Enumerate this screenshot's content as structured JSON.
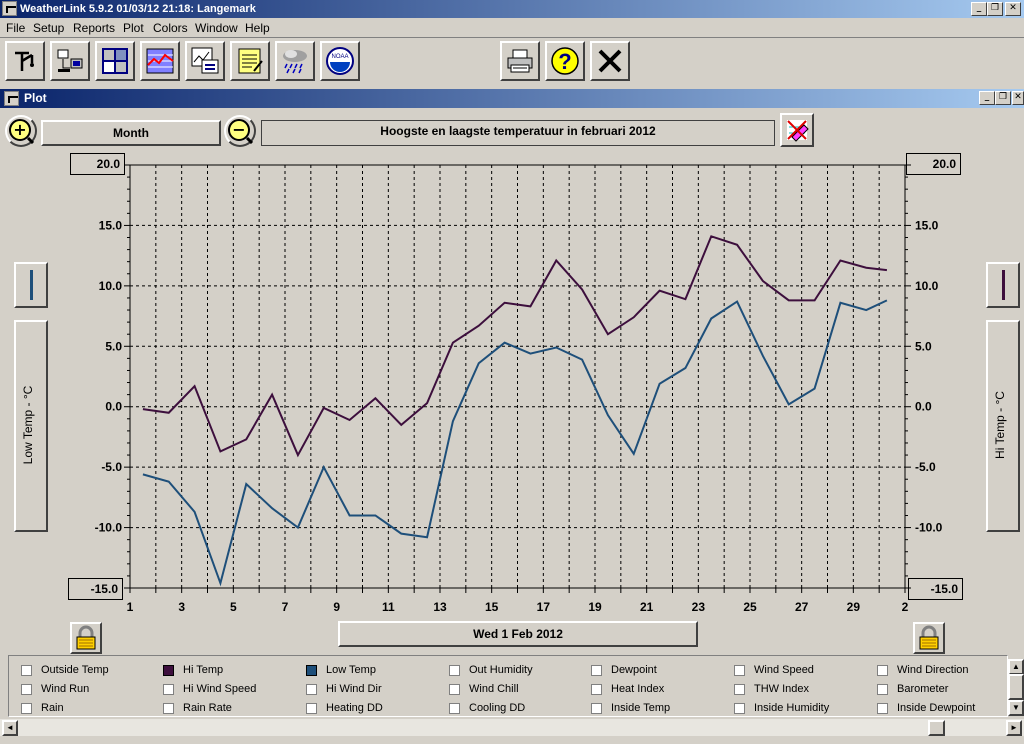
{
  "app": {
    "title": "WeatherLink 5.9.2  01/03/12  21:18: Langemark",
    "buttons": {
      "minimize": "_",
      "restore": "❐",
      "close": "✕"
    }
  },
  "menu": [
    "File",
    "Setup",
    "Reports",
    "Plot",
    "Colors",
    "Window",
    "Help"
  ],
  "toolbar": {
    "icons": [
      "weather-station-icon",
      "download-icon",
      "bulletin-icon",
      "strip-chart-icon",
      "plot-icon",
      "notepad-icon",
      "rain-icon",
      "noaa-icon"
    ],
    "right_icons": [
      "print-icon",
      "help-icon",
      "close-icon"
    ],
    "help_glyph": "?",
    "close_glyph": "✕",
    "noaa_text": "NOAA"
  },
  "plot_window": {
    "title": "Plot",
    "zoom_in": "+",
    "zoom_out": "−",
    "span": "Month",
    "chart_title": "Hoogste en laagste temperatuur in februari 2012",
    "date_button": "Wed 1 Feb 2012",
    "left_axis_label": "Low Temp - °C",
    "right_axis_label": "Hi Temp - °C"
  },
  "chart_data": {
    "type": "line",
    "title": "Hoogste en laagste temperatuur in februari 2012",
    "xlabel": "Wed 1 Feb 2012",
    "ylabel": "Low Temp - °C",
    "y2label": "Hi Temp - °C",
    "ylim": [
      -15,
      20
    ],
    "y_ticks": [
      "20.0",
      "15.0",
      "10.0",
      "5.0",
      "0.0",
      "-5.0",
      "-10.0",
      "-15.0"
    ],
    "x_ticks": [
      "1",
      "3",
      "5",
      "7",
      "9",
      "11",
      "13",
      "15",
      "17",
      "19",
      "21",
      "23",
      "25",
      "27",
      "29",
      "2"
    ],
    "grid": true,
    "series": [
      {
        "name": "Hi Temp",
        "color": "#3d0f3d",
        "x": [
          1.5,
          2.5,
          3.5,
          4.5,
          5.5,
          6.5,
          7.5,
          8.5,
          9.5,
          10.5,
          11.5,
          12.5,
          13.5,
          14.5,
          15.5,
          16.5,
          17.5,
          18.5,
          19.5,
          20.5,
          21.5,
          22.5,
          23.5,
          24.5,
          25.5,
          26.5,
          27.5,
          28.5,
          29.5,
          30.3
        ],
        "values": [
          -0.2,
          -0.5,
          1.7,
          -3.7,
          -2.7,
          1.0,
          -4.0,
          -0.1,
          -1.1,
          0.7,
          -1.5,
          0.3,
          5.3,
          6.7,
          8.6,
          8.3,
          12.1,
          9.7,
          6.0,
          7.4,
          9.6,
          8.9,
          14.1,
          13.4,
          10.4,
          8.8,
          8.8,
          12.1,
          11.5,
          11.3
        ]
      },
      {
        "name": "Low Temp",
        "color": "#1e4f7a",
        "x": [
          1.5,
          2.5,
          3.5,
          4.5,
          5.5,
          6.5,
          7.5,
          8.5,
          9.5,
          10.5,
          11.5,
          12.5,
          13.5,
          14.5,
          15.5,
          16.5,
          17.5,
          18.5,
          19.5,
          20.5,
          21.5,
          22.5,
          23.5,
          24.5,
          25.5,
          26.5,
          27.5,
          28.5,
          29.5,
          30.3
        ],
        "values": [
          -5.6,
          -6.2,
          -8.7,
          -14.6,
          -6.4,
          -8.4,
          -10.0,
          -5.0,
          -9.0,
          -9.0,
          -10.5,
          -10.8,
          -1.2,
          3.6,
          5.3,
          4.4,
          4.9,
          3.9,
          -0.7,
          -3.9,
          1.9,
          3.2,
          7.3,
          8.7,
          4.2,
          0.2,
          1.5,
          8.6,
          8.0,
          8.8
        ]
      }
    ]
  },
  "legend": {
    "rows": [
      [
        {
          "label": "Outside Temp"
        },
        {
          "label": "Hi Temp",
          "color": "#3d0f3d"
        },
        {
          "label": "Low Temp",
          "color": "#1e4f7a"
        },
        {
          "label": "Out Humidity"
        },
        {
          "label": "Dewpoint"
        },
        {
          "label": "Wind Speed"
        },
        {
          "label": "Wind Direction"
        }
      ],
      [
        {
          "label": "Wind Run"
        },
        {
          "label": "Hi Wind Speed"
        },
        {
          "label": "Hi Wind Dir"
        },
        {
          "label": "Wind Chill"
        },
        {
          "label": "Heat Index"
        },
        {
          "label": "THW Index"
        },
        {
          "label": "Barometer"
        }
      ],
      [
        {
          "label": "Rain"
        },
        {
          "label": "Rain Rate"
        },
        {
          "label": "Heating DD"
        },
        {
          "label": "Cooling DD"
        },
        {
          "label": "Inside Temp"
        },
        {
          "label": "Inside Humidity"
        },
        {
          "label": "Inside Dewpoint"
        }
      ]
    ]
  },
  "scroll": {
    "up": "▲",
    "down": "▼",
    "left": "◄",
    "right": "►"
  }
}
